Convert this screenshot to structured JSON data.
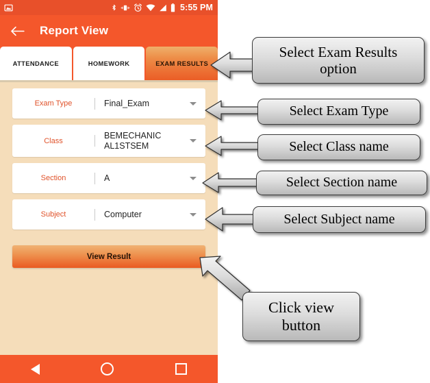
{
  "phone": {
    "statusbar": {
      "icons": [
        "image-icon",
        "bluetooth-icon",
        "vibrate-icon",
        "alarm-icon",
        "wifi-icon",
        "signal-icon",
        "battery-icon"
      ],
      "time": "5:55 PM"
    },
    "appbar": {
      "back_icon": "back-arrow-icon",
      "title": "Report View"
    },
    "tabs": [
      {
        "label": "ATTENDANCE",
        "active": false
      },
      {
        "label": "HOMEWORK",
        "active": false
      },
      {
        "label": "EXAM RESULTS",
        "active": true
      }
    ],
    "form": {
      "fields": [
        {
          "label": "Exam Type",
          "value": "Final_Exam"
        },
        {
          "label": "Class",
          "value": "BEMECHANIC\nAL1STSEM"
        },
        {
          "label": "Section",
          "value": "A"
        },
        {
          "label": "Subject",
          "value": "Computer"
        }
      ]
    },
    "view_button": {
      "label": "View Result"
    },
    "navbar": {
      "back": "nav-back-icon",
      "home": "nav-home-icon",
      "recents": "nav-recents-icon"
    }
  },
  "annotations": [
    {
      "id": "exam-results-callout",
      "text": "Select Exam Results option"
    },
    {
      "id": "exam-type-callout",
      "text": "Select Exam Type"
    },
    {
      "id": "class-callout",
      "text": "Select Class name"
    },
    {
      "id": "section-callout",
      "text": "Select Section name"
    },
    {
      "id": "subject-callout",
      "text": "Select Subject name"
    },
    {
      "id": "view-button-callout",
      "text": "Click view button"
    }
  ],
  "colors": {
    "status_bar": "#E8502A",
    "app_bar": "#F4572B",
    "page_background": "#F5DDBA",
    "accent_label": "#E0522A",
    "callout_border": "#3A3A3A"
  }
}
